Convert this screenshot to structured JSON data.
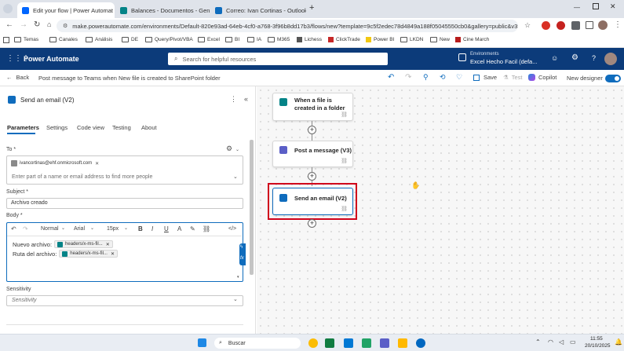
{
  "browser": {
    "tabs": [
      {
        "label": "Edit your flow | Power Automat",
        "color": "#0066ff",
        "active": true
      },
      {
        "label": "Balances - Documentos - Gene",
        "color": "#038387",
        "active": false
      },
      {
        "label": "Correo: Ivan Cortinas - Outlook",
        "color": "#0f6cbd",
        "active": false
      }
    ],
    "new_tab": "+",
    "url": "make.powerautomate.com/environments/Default-820e93ad-64eb-4cf0-a768-3f96b8dd17b3/flows/new?template=9c5f2edec78d4849a188f05045550cb0&gallery=public&v3=...",
    "bookmarks": [
      "Temas",
      "Canales",
      "Análisis",
      "DE",
      "Query/Pivot/VBA",
      "Excel",
      "BI",
      "IA",
      "M365",
      "Lichess",
      "ClickTrade",
      "Power BI",
      "LKDN",
      "New",
      "Cine March"
    ]
  },
  "app": {
    "name": "Power Automate",
    "search_placeholder": "Search for helpful resources",
    "env_label": "Environments",
    "env_name": "Excel Hecho Facil (defa..."
  },
  "cmdbar": {
    "back": "Back",
    "title": "Post message to Teams when New file is created to SharePoint folder",
    "save": "Save",
    "test": "Test",
    "copilot": "Copilot",
    "new_designer": "New designer"
  },
  "panel": {
    "title": "Send an email (V2)",
    "tabs": [
      "Parameters",
      "Settings",
      "Code view",
      "Testing",
      "About"
    ],
    "to_label": "To *",
    "to_chip": "ivancortinas@ehf.onmicrosoft.com",
    "to_placeholder": "Enter part of a name or email address to find more people",
    "subject_label": "Subject *",
    "subject_value": "Archivo creado",
    "body_label": "Body *",
    "toolbar": {
      "style": "Normal",
      "font": "Arial",
      "size": "15px",
      "bold": "B",
      "italic": "I",
      "underline": "U",
      "code": "</>"
    },
    "body_line1": "Nuevo archivo:",
    "body_line2": "Ruta del archivo:",
    "body_chip": "headers/x-ms-fil...",
    "sensitivity_label": "Sensitivity",
    "sensitivity_placeholder": "Sensitivity"
  },
  "flow": {
    "steps": [
      {
        "label": "When a file is created in a folder"
      },
      {
        "label": "Post a message (V3)"
      },
      {
        "label": "Send an email (V2)"
      }
    ],
    "highlight_color": "#d0021b"
  },
  "taskbar": {
    "search": "Buscar",
    "time": "11:55",
    "date": "20/10/2025"
  }
}
